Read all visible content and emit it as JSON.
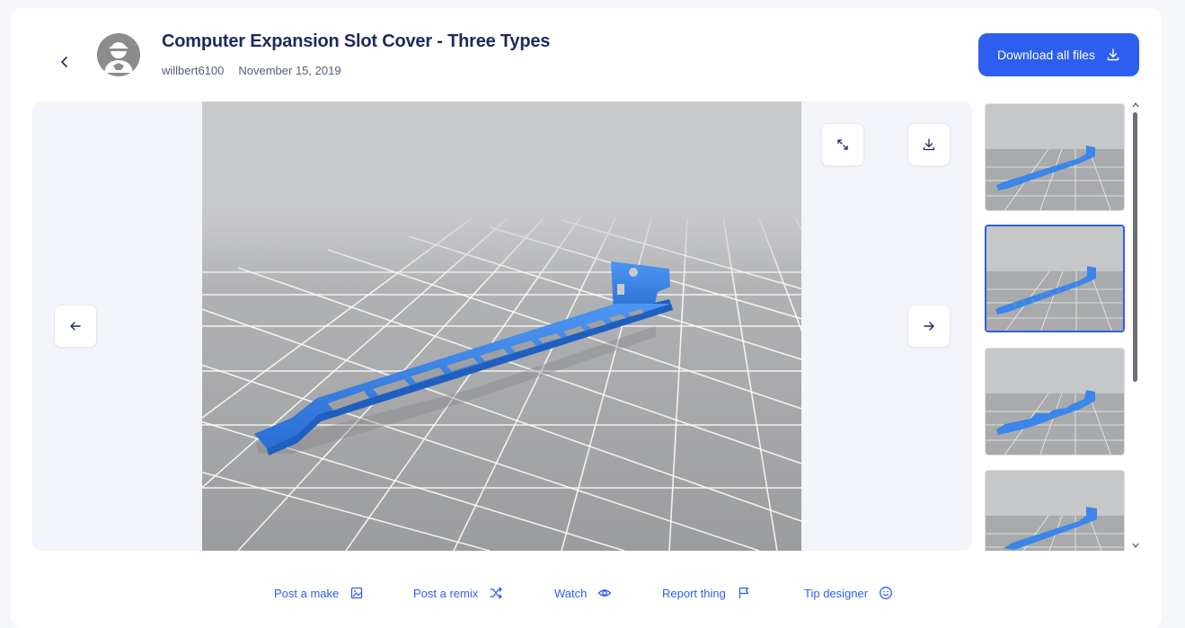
{
  "header": {
    "title": "Computer Expansion Slot Cover - Three Types",
    "author": "willbert6100",
    "date": "November 15, 2019",
    "download_label": "Download all files"
  },
  "actions": [
    {
      "label": "Post a make",
      "icon": "image-icon"
    },
    {
      "label": "Post a remix",
      "icon": "shuffle-icon"
    },
    {
      "label": "Watch",
      "icon": "eye-icon"
    },
    {
      "label": "Report thing",
      "icon": "flag-icon"
    },
    {
      "label": "Tip designer",
      "icon": "smile-icon"
    }
  ],
  "thumbnails": [
    {
      "variant": "solid",
      "selected": false
    },
    {
      "variant": "vented",
      "selected": true
    },
    {
      "variant": "notched",
      "selected": false
    },
    {
      "variant": "solid",
      "selected": false
    }
  ],
  "colors": {
    "accent": "#2e5ef0",
    "model_blue": "#2f7de0",
    "title": "#1d2a5c"
  }
}
